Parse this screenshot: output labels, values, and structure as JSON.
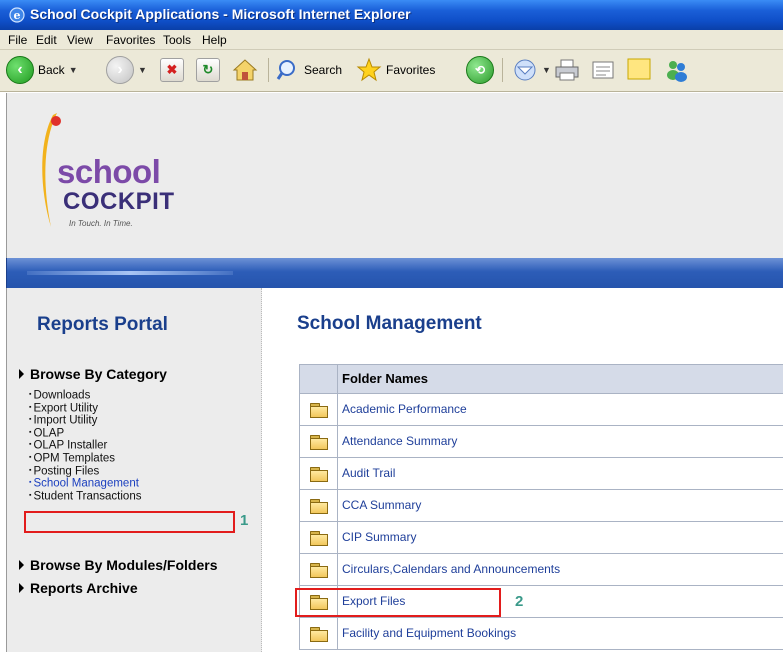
{
  "window": {
    "title": "School Cockpit Applications - Microsoft Internet Explorer"
  },
  "menubar": [
    "File",
    "Edit",
    "View",
    "Favorites",
    "Tools",
    "Help"
  ],
  "toolbar": {
    "back_label": "Back",
    "search_label": "Search",
    "favorites_label": "Favorites"
  },
  "logo": {
    "line1": "school",
    "line2": "COCKPIT",
    "tagline": "In Touch. In Time."
  },
  "sidebar": {
    "title": "Reports Portal",
    "browse_category": "Browse By Category",
    "category_items": [
      "Downloads",
      "Export Utility",
      "Import Utility",
      "OLAP",
      "OLAP Installer",
      "OPM Templates",
      "Posting Files",
      "School Management",
      "Student Transactions"
    ],
    "browse_modules": "Browse By Modules/Folders",
    "reports_archive": "Reports Archive"
  },
  "main": {
    "title": "School Management",
    "table_header": "Folder Names",
    "folders": [
      "Academic Performance",
      "Attendance Summary",
      "Audit Trail",
      "CCA Summary",
      "CIP Summary",
      "Circulars,Calendars and Announcements",
      "Export Files",
      "Facility and Equipment Bookings"
    ]
  },
  "annotations": {
    "marker1": "1",
    "marker2": "2",
    "highlight_color": "#e21c1c"
  }
}
